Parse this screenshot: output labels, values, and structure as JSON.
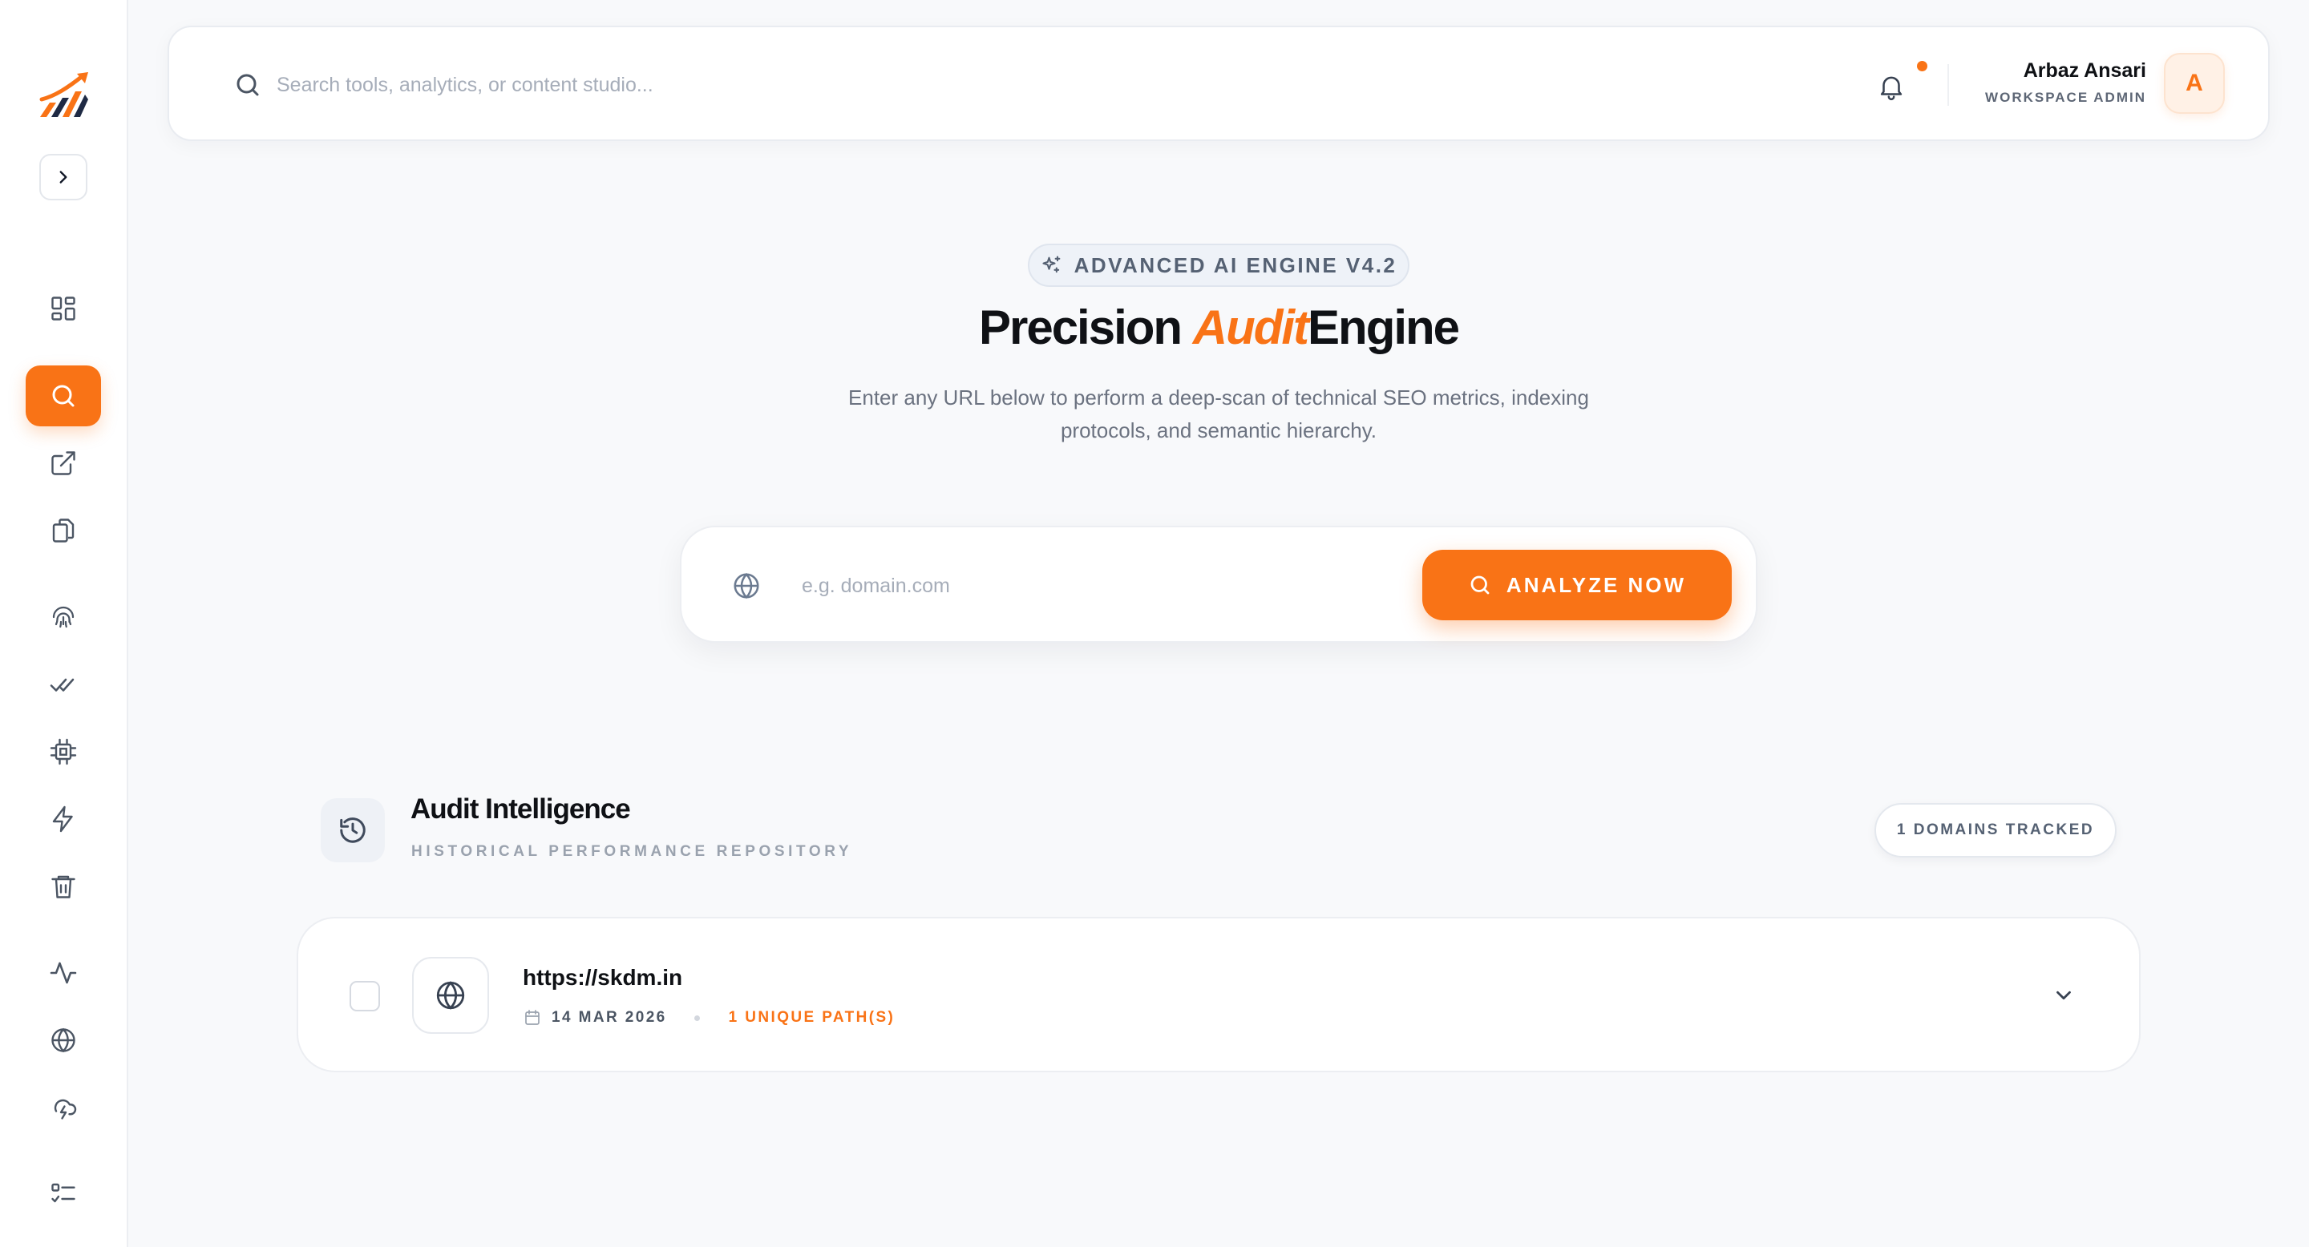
{
  "topbar": {
    "search_placeholder": "Search tools, analytics, or content studio...",
    "user": {
      "name": "Arbaz Ansari",
      "role": "WORKSPACE ADMIN",
      "avatar_initial": "A"
    },
    "notification_indicator": true
  },
  "sidebar": {
    "logo": "brand-logo",
    "collapse_icon": "chevron-right-icon",
    "items": [
      {
        "icon": "dashboard-grid-icon",
        "active": false
      },
      {
        "icon": "search-icon",
        "active": true
      },
      {
        "icon": "external-link-icon",
        "active": false
      },
      {
        "icon": "copy-files-icon",
        "active": false
      },
      {
        "icon": "fingerprint-icon",
        "active": false
      },
      {
        "icon": "double-check-icon",
        "active": false
      },
      {
        "icon": "cpu-chip-icon",
        "active": false
      },
      {
        "icon": "lightning-icon",
        "active": false
      },
      {
        "icon": "trash-icon",
        "active": false
      },
      {
        "icon": "activity-pulse-icon",
        "active": false
      },
      {
        "icon": "globe-icon",
        "active": false
      },
      {
        "icon": "cloud-lightning-icon",
        "active": false
      },
      {
        "icon": "checklist-icon",
        "active": false
      }
    ]
  },
  "hero": {
    "badge": "ADVANCED AI ENGINE V4.2",
    "title_before": "Precision",
    "title_accent": "Audit",
    "title_after": "Engine",
    "subtitle": "Enter any URL below to perform a deep-scan of technical SEO metrics, indexing protocols, and semantic hierarchy."
  },
  "analyzer": {
    "placeholder": "e.g. domain.com",
    "button_label": "ANALYZE NOW"
  },
  "audit_section": {
    "title": "Audit Intelligence",
    "subtitle": "HISTORICAL PERFORMANCE REPOSITORY",
    "domains_badge": "1 DOMAINS TRACKED",
    "rows": [
      {
        "url": "https://skdm.in",
        "date": "14 MAR 2026",
        "paths": "1 UNIQUE PATH(S)",
        "checked": false
      }
    ]
  },
  "colors": {
    "accent": "#f97316",
    "background": "#f8f9fb",
    "text_primary": "#0f1115",
    "text_muted": "#6b7280"
  }
}
